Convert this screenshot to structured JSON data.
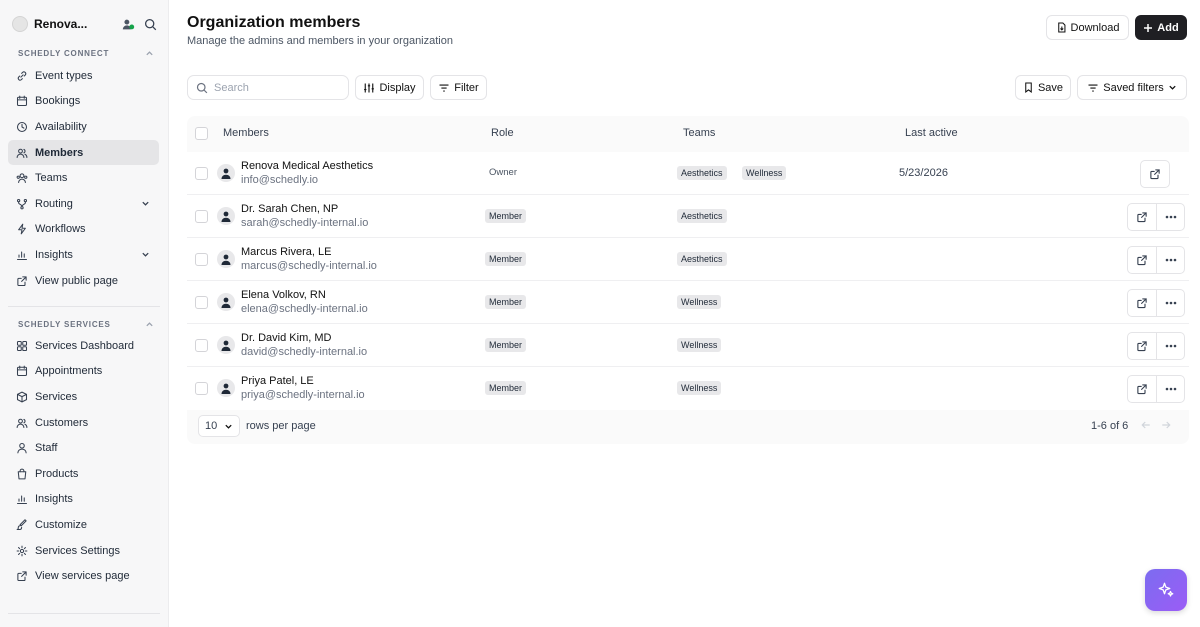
{
  "sidebar": {
    "org_name": "Renova...",
    "section1": "SCHEDLY CONNECT",
    "section2": "SCHEDLY SERVICES",
    "connect_items": [
      {
        "label": "Event types",
        "icon": "link-icon"
      },
      {
        "label": "Bookings",
        "icon": "calendar-icon"
      },
      {
        "label": "Availability",
        "icon": "clock-icon"
      },
      {
        "label": "Members",
        "icon": "users-icon",
        "active": true
      },
      {
        "label": "Teams",
        "icon": "team-icon"
      },
      {
        "label": "Routing",
        "icon": "routing-icon",
        "chevron": true
      },
      {
        "label": "Workflows",
        "icon": "workflow-icon"
      },
      {
        "label": "Insights",
        "icon": "chart-icon",
        "chevron": true
      },
      {
        "label": "View public page",
        "icon": "external-link-icon"
      }
    ],
    "services_items": [
      {
        "label": "Services Dashboard",
        "icon": "dashboard-icon"
      },
      {
        "label": "Appointments",
        "icon": "calendar-icon"
      },
      {
        "label": "Services",
        "icon": "box-icon"
      },
      {
        "label": "Customers",
        "icon": "users-icon"
      },
      {
        "label": "Staff",
        "icon": "staff-icon"
      },
      {
        "label": "Products",
        "icon": "bag-icon"
      },
      {
        "label": "Insights",
        "icon": "chart-icon"
      },
      {
        "label": "Customize",
        "icon": "brush-icon"
      },
      {
        "label": "Services Settings",
        "icon": "gear-icon"
      },
      {
        "label": "View services page",
        "icon": "external-link-icon"
      }
    ]
  },
  "header": {
    "title": "Organization members",
    "subtitle": "Manage the admins and members in your organization",
    "download_label": "Download",
    "add_label": "Add"
  },
  "toolbar": {
    "search_placeholder": "Search",
    "display_label": "Display",
    "filter_label": "Filter",
    "save_label": "Save",
    "saved_filters_label": "Saved filters"
  },
  "table": {
    "headers": {
      "members": "Members",
      "role": "Role",
      "teams": "Teams",
      "last_active": "Last active"
    },
    "rows": [
      {
        "name": "Renova Medical Aesthetics",
        "email": "info@schedly.io",
        "role": "Owner",
        "role_badge": false,
        "teams": [
          "Aesthetics",
          "Wellness"
        ],
        "last_active": "5/23/2026",
        "more": false
      },
      {
        "name": "Dr. Sarah Chen, NP",
        "email": "sarah@schedly-internal.io",
        "role": "Member",
        "role_badge": true,
        "teams": [
          "Aesthetics"
        ],
        "last_active": "",
        "more": true
      },
      {
        "name": "Marcus Rivera, LE",
        "email": "marcus@schedly-internal.io",
        "role": "Member",
        "role_badge": true,
        "teams": [
          "Aesthetics"
        ],
        "last_active": "",
        "more": true
      },
      {
        "name": "Elena Volkov, RN",
        "email": "elena@schedly-internal.io",
        "role": "Member",
        "role_badge": true,
        "teams": [
          "Wellness"
        ],
        "last_active": "",
        "more": true
      },
      {
        "name": "Dr. David Kim, MD",
        "email": "david@schedly-internal.io",
        "role": "Member",
        "role_badge": true,
        "teams": [
          "Wellness"
        ],
        "last_active": "",
        "more": true
      },
      {
        "name": "Priya Patel, LE",
        "email": "priya@schedly-internal.io",
        "role": "Member",
        "role_badge": true,
        "teams": [
          "Wellness"
        ],
        "last_active": "",
        "more": true
      }
    ],
    "footer": {
      "rows_per_page_value": "10",
      "rows_per_page_label": "rows per page",
      "range": "1-6 of 6"
    }
  }
}
